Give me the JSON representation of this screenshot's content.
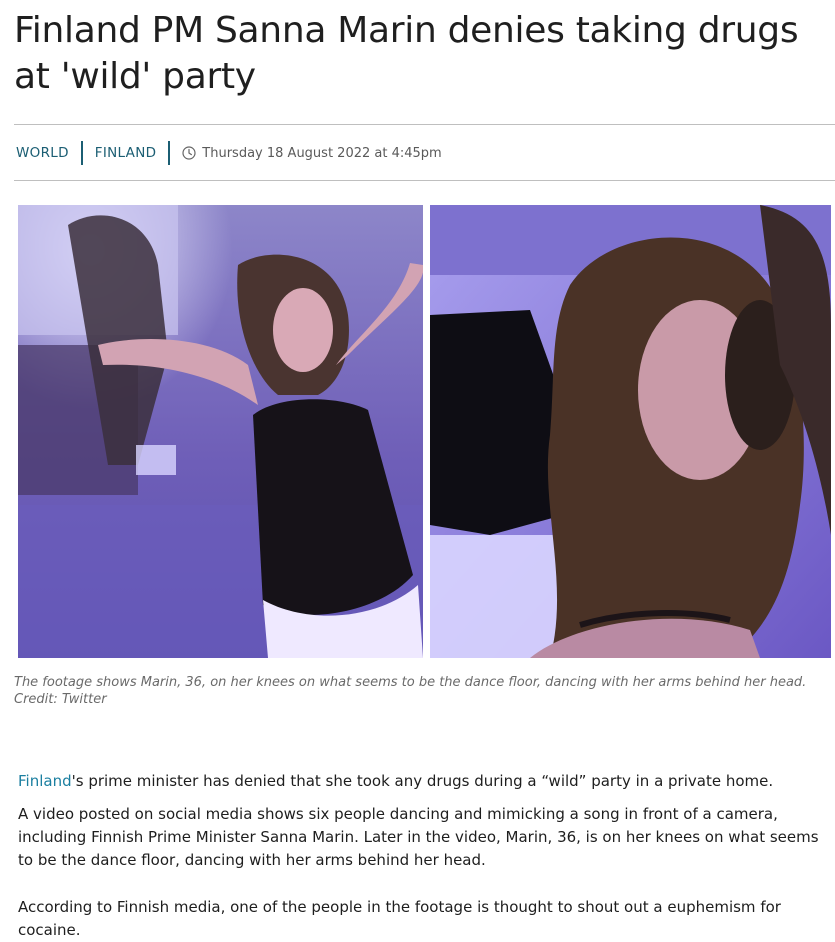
{
  "article": {
    "headline": "Finland PM Sanna Marin denies taking drugs at 'wild' party",
    "tags": [
      "WORLD",
      "FINLAND"
    ],
    "date": "Thursday 18 August 2022 at 4:45pm",
    "icons": {
      "clock": "clock-icon"
    },
    "colors": {
      "tag": "#1b5e73",
      "link": "#1b7fa0"
    }
  },
  "image": {
    "caption": "The footage shows Marin, 36, on her knees on what seems to be the dance floor, dancing with her arms behind her head.",
    "credit": "Credit: Twitter"
  },
  "body": {
    "p1_link": "Finland",
    "p1_rest": "'s prime minister has denied that she took any drugs during a “wild” party in a private home.",
    "p2": "A video posted on social media shows six people dancing and mimicking a song in front of a camera, including Finnish Prime Minister Sanna Marin. Later in the video, Marin, 36, is on her knees on what seems to be the dance floor, dancing with her arms behind her head.",
    "p3": "According to Finnish media, one of the people in the footage is thought to shout out a euphemism for cocaine."
  }
}
